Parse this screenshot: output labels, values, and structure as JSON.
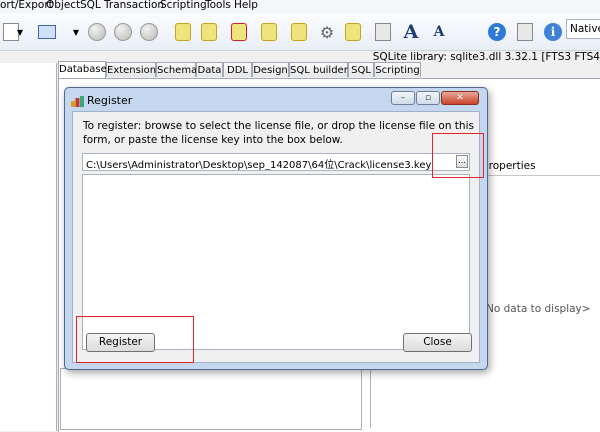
{
  "menu": [
    "ort/Export",
    "Object",
    "SQL",
    "Transaction",
    "Scripting",
    "Tools",
    "Help"
  ],
  "toolbar": {
    "mode_value": "Native",
    "icons": [
      "new-icon",
      "dropdown-arrow-icon",
      "script-icon",
      "dropdown-arrow-icon",
      "play-icon",
      "step-icon",
      "stop-icon",
      "scroll-icon",
      "scroll-icon",
      "scroll-delete-icon",
      "scroll-icon",
      "scroll-icon",
      "gear-icon",
      "scroll-icon",
      "dll-icon",
      "font-increase-icon",
      "font-decrease-icon",
      "help-icon",
      "dll-icon",
      "info-icon"
    ]
  },
  "library_info": "SQLite library: sqlite3.dll 3.32.1 [FTS3 FTS4",
  "tabs": [
    "Database",
    "Extensions",
    "Schema",
    "Data",
    "DDL",
    "Design",
    "SQL builder",
    "SQL",
    "Scripting"
  ],
  "active_tab": "Database",
  "properties_header": "properties",
  "no_data_text": "No data to display>",
  "dialog": {
    "title": "Register",
    "instructions": "To register: browse to select the license file, or drop the license file on this form, or paste the license key into the box below.",
    "license_path": "C:\\Users\\Administrator\\Desktop\\sep_142087\\64位\\Crack\\license3.key",
    "browse_label": "...",
    "key_text": "",
    "register_label": "Register",
    "close_label": "Close",
    "minimize_glyph": "–",
    "maximize_glyph": "▫",
    "close_glyph": "✕"
  },
  "colors": {
    "highlight": "#e0242a",
    "dialog_frame": "#c4d7ee"
  }
}
